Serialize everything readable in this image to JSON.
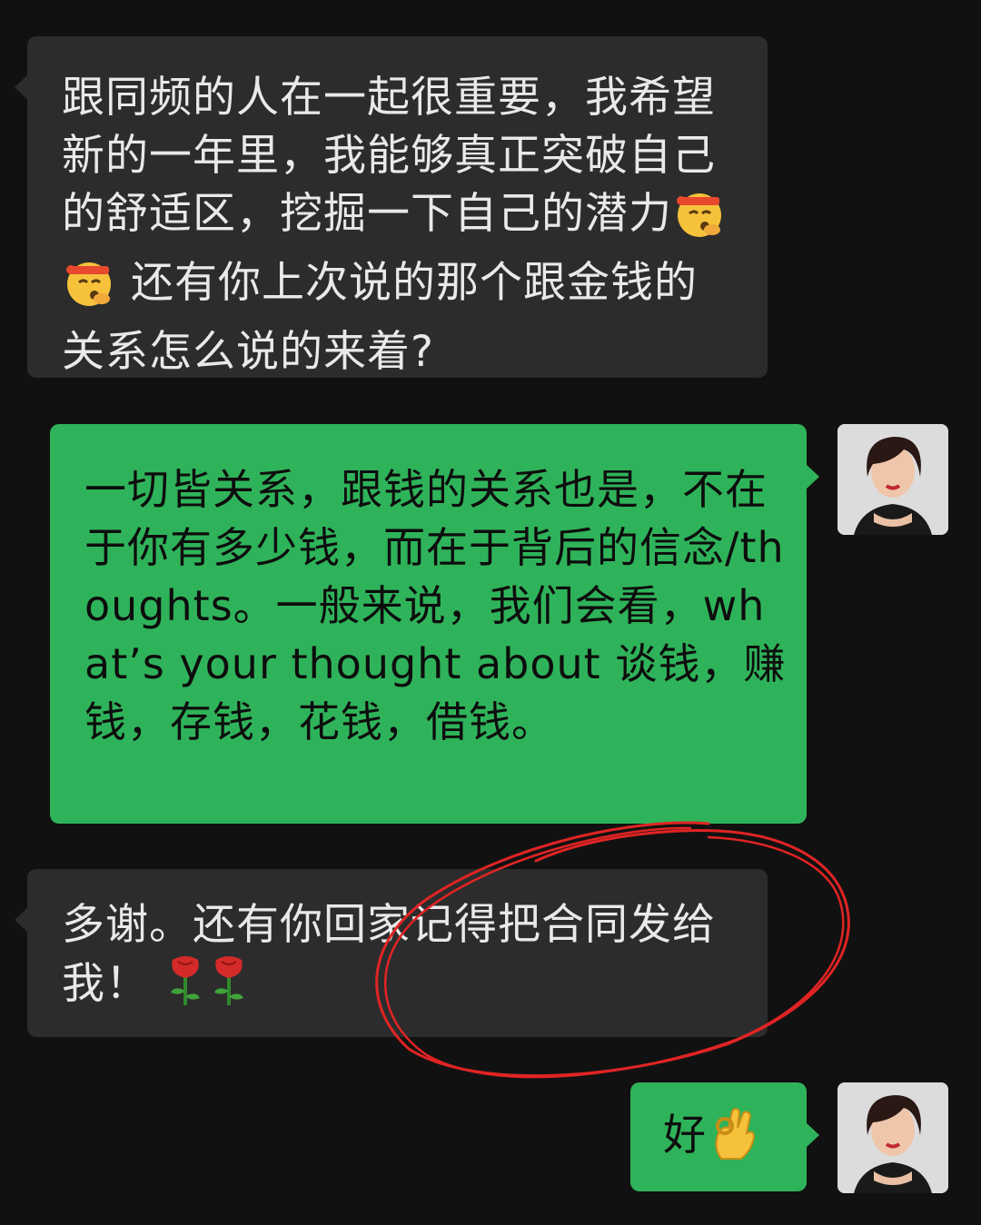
{
  "messages": [
    {
      "direction": "incoming",
      "text_part1": "跟同频的人在一起很重要，我希望新的一年里，我能够真正突破自己的舒适区，挖掘一下自己的潜力",
      "emojis_mid": [
        "sweating-face-headband-emoji",
        "sweating-face-headband-emoji"
      ],
      "text_part2": " 还有你上次说的那个跟金钱的关系怎么说的来着?"
    },
    {
      "direction": "outgoing",
      "text": "一切皆关系，跟钱的关系也是，不在于你有多少钱，而在于背后的信念/thoughts。一般来说，我们会看，what’s your thought about 谈钱，赚钱，存钱，花钱，借钱。"
    },
    {
      "direction": "incoming",
      "text": "多谢。还有你回家记得把合同发给我！",
      "emojis_end": [
        "rose-emoji",
        "rose-emoji"
      ]
    },
    {
      "direction": "outgoing",
      "text": "好",
      "emojis_end": [
        "ok-hand-emoji"
      ]
    }
  ],
  "colors": {
    "background": "#111111",
    "incoming_bubble": "#2c2c2c",
    "outgoing_bubble": "#2fb35a",
    "annotation_circle": "#e02424"
  }
}
